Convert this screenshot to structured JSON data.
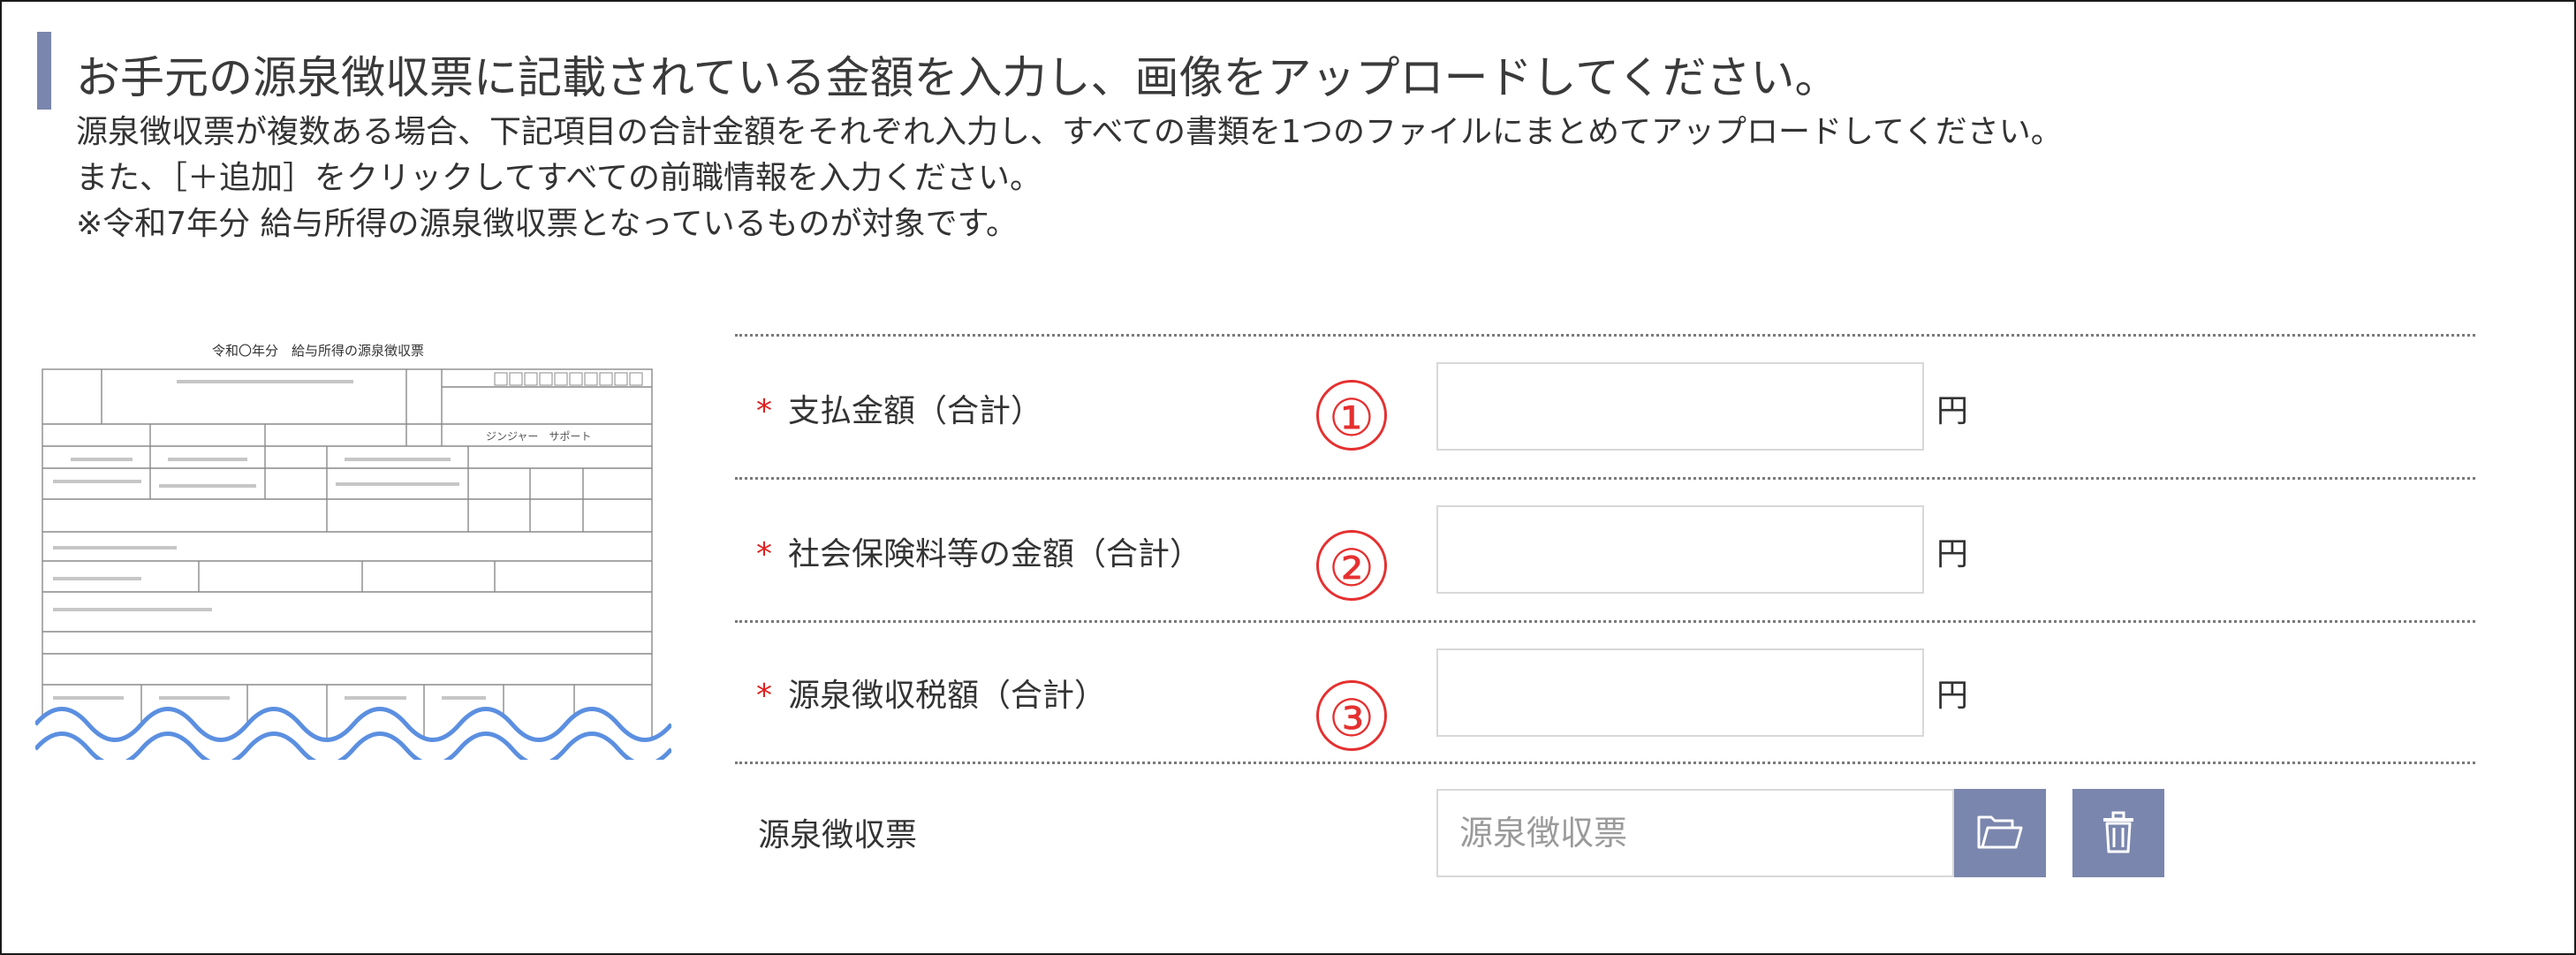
{
  "instructions": {
    "heading": "お手元の源泉徴収票に記載されている金額を入力し、画像をアップロードしてください。",
    "note_1": "源泉徴収票が複数ある場合、下記項目の合計金額をそれぞれ入力し、すべての書類を1つのファイルにまとめてアップロードしてください。",
    "note_2": "また、［＋追加］をクリックしてすべての前職情報を入力ください。",
    "note_3": "※令和7年分 給与所得の源泉徴収票となっているものが対象です。"
  },
  "slip_image": {
    "title": "令和〇年分　給与所得の源泉徴収票",
    "name": "ジンジャー　サポート"
  },
  "form": {
    "required_mark": "*",
    "currency_unit": "円",
    "fields": [
      {
        "label": "支払金額（合計）",
        "marker": "①",
        "value": ""
      },
      {
        "label": "社会保険料等の金額（合計）",
        "marker": "②",
        "value": ""
      },
      {
        "label": "源泉徴収税額（合計）",
        "marker": "③",
        "value": ""
      }
    ],
    "file": {
      "label": "源泉徴収票",
      "placeholder": "源泉徴収票",
      "browse_icon": "folder-open-icon",
      "delete_icon": "trash-icon"
    }
  },
  "colors": {
    "accent": "#7a86ad",
    "required": "#e02020",
    "marker": "#e53030",
    "wave": "#5b8fe0"
  }
}
